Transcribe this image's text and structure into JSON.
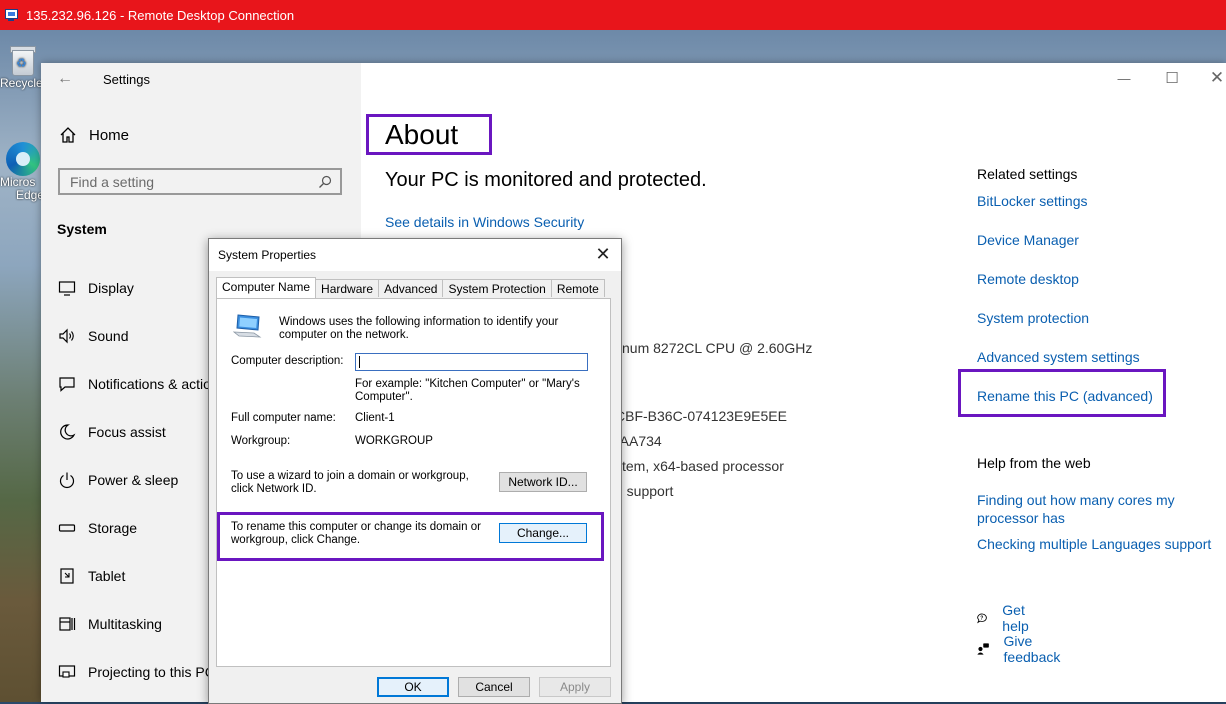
{
  "rdp": {
    "title": "135.232.96.126 - Remote Desktop Connection"
  },
  "desktop": {
    "recycle_label": "Recycle",
    "edge_label_1": "Micros",
    "edge_label_2": "Edge"
  },
  "settings": {
    "window_title": "Settings",
    "home": "Home",
    "search_placeholder": "Find a setting",
    "section": "System",
    "nav": [
      {
        "label": "Display",
        "icon": "display-icon"
      },
      {
        "label": "Sound",
        "icon": "sound-icon"
      },
      {
        "label": "Notifications & actio",
        "icon": "notifications-icon"
      },
      {
        "label": "Focus assist",
        "icon": "focus-assist-icon"
      },
      {
        "label": "Power & sleep",
        "icon": "power-icon"
      },
      {
        "label": "Storage",
        "icon": "storage-icon"
      },
      {
        "label": "Tablet",
        "icon": "tablet-icon"
      },
      {
        "label": "Multitasking",
        "icon": "multitasking-icon"
      },
      {
        "label": "Projecting to this PC",
        "icon": "projecting-icon"
      }
    ]
  },
  "about": {
    "title": "About",
    "protected": "Your PC is monitored and protected.",
    "security_link": "See details in Windows Security",
    "spec_lines": [
      "tinum 8272CL CPU @ 2.60GHz",
      "CBF-B36C-074123E9E5EE",
      "-AA734",
      "stem, x64-based processor",
      "h support"
    ]
  },
  "related": {
    "header": "Related settings",
    "links": [
      "BitLocker settings",
      "Device Manager",
      "Remote desktop",
      "System protection",
      "Advanced system settings",
      "Rename this PC (advanced)"
    ],
    "help_header": "Help from the web",
    "help_links": [
      "Finding out how many cores my processor has",
      "Checking multiple Languages support"
    ],
    "get_help": "Get help",
    "give_feedback": "Give feedback"
  },
  "dialog": {
    "title": "System Properties",
    "tabs": [
      "Computer Name",
      "Hardware",
      "Advanced",
      "System Protection",
      "Remote"
    ],
    "intro": "Windows uses the following information to identify your computer on the network.",
    "desc_label": "Computer description:",
    "desc_value": "",
    "example": "For example: \"Kitchen Computer\" or \"Mary's Computer\".",
    "full_name_label": "Full computer name:",
    "full_name_value": "Client-1",
    "workgroup_label": "Workgroup:",
    "workgroup_value": "WORKGROUP",
    "wizard_text": "To use a wizard to join a domain or workgroup, click Network ID.",
    "network_id_btn": "Network ID...",
    "rename_text": "To rename this computer or change its domain or workgroup, click Change.",
    "change_btn": "Change...",
    "ok": "OK",
    "cancel": "Cancel",
    "apply": "Apply"
  }
}
